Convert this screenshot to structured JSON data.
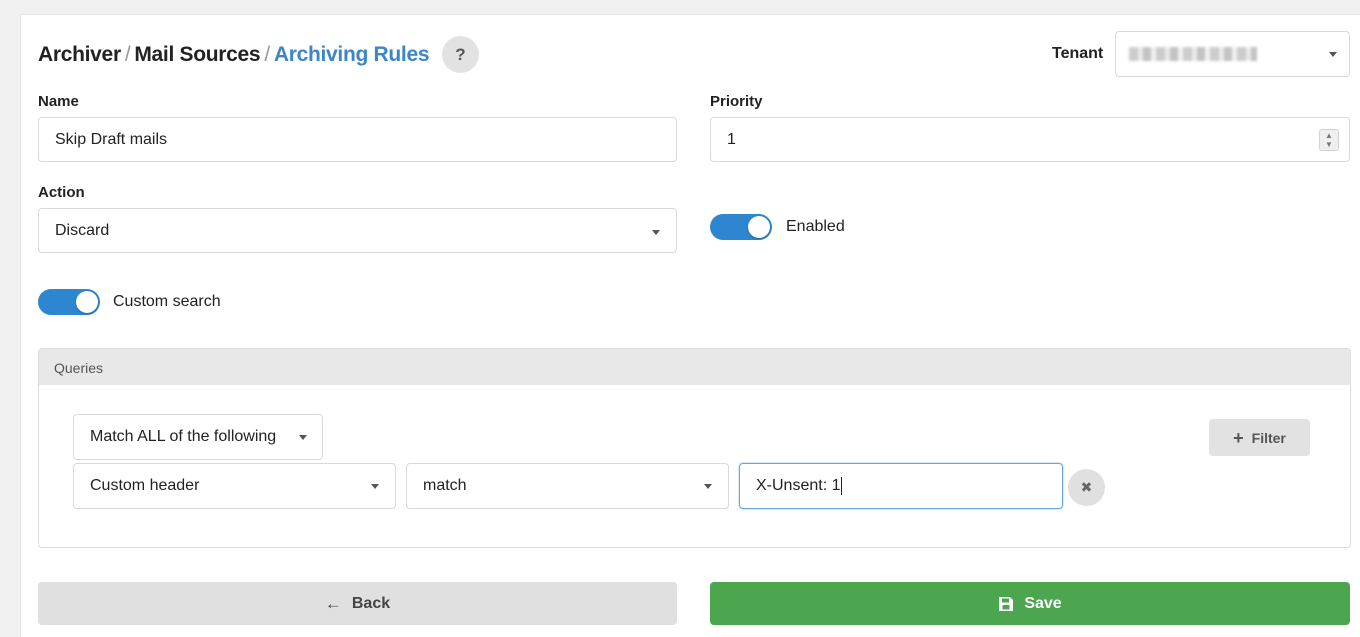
{
  "header": {
    "breadcrumb": [
      {
        "label": "Archiver"
      },
      {
        "label": "Mail Sources"
      },
      {
        "label": "Archiving Rules"
      }
    ],
    "separator": "/",
    "help_label": "?",
    "tenant_label": "Tenant"
  },
  "form": {
    "name_label": "Name",
    "name_value": "Skip Draft mails",
    "priority_label": "Priority",
    "priority_value": "1",
    "action_label": "Action",
    "action_value": "Discard",
    "enabled_label": "Enabled",
    "enabled": true,
    "custom_search_label": "Custom search",
    "custom_search": true
  },
  "queries": {
    "title": "Queries",
    "match_mode": "Match ALL of the following",
    "filter_button": "Filter",
    "rules": [
      {
        "field": "Custom header",
        "operator": "match",
        "value": "X-Unsent: 1"
      }
    ]
  },
  "footer": {
    "back_label": "Back",
    "save_label": "Save"
  },
  "colors": {
    "accent": "#2f86d0",
    "breadcrumb_active": "#3a86c8",
    "save": "#4ba64f"
  }
}
